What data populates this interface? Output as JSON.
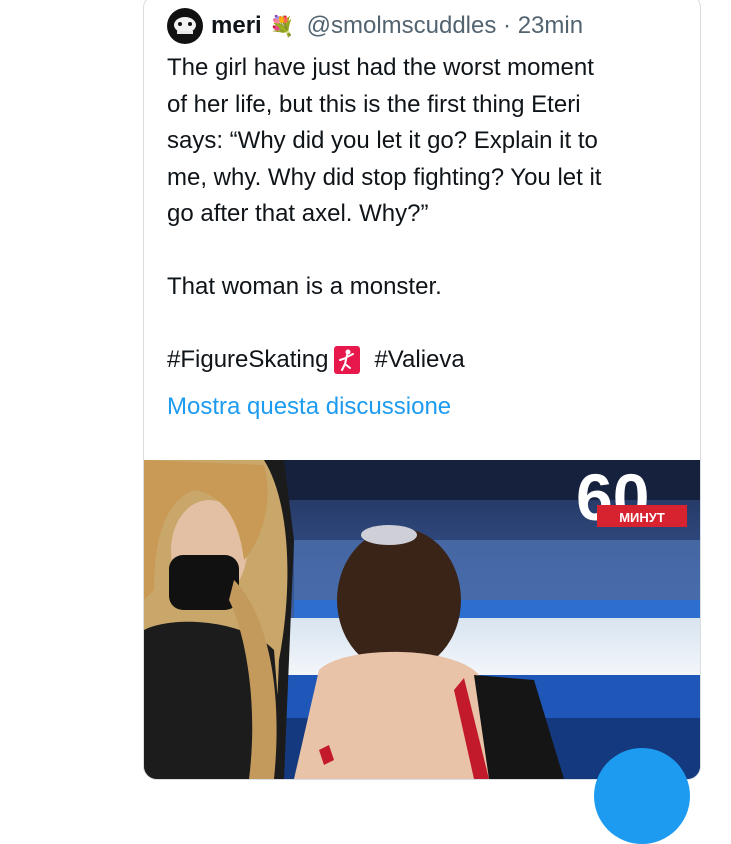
{
  "tweet": {
    "display_name": "meri",
    "name_emoji": "💐",
    "handle": "@smolmscuddles",
    "separator": "·",
    "time": "23min",
    "text_lines": [
      "The girl have just had the worst moment",
      "of her life, but this is the first thing Eteri",
      "says: “Why did you let it go? Explain it to",
      "me, why. Why did stop fighting? You let it",
      "go after that axel. Why?”"
    ],
    "text_line2": "That woman is a monster.",
    "hashtag1": "#FigureSkating",
    "hashtag1_emoji": "figure-skating-emoji",
    "hashtag2": "#Valieva",
    "show_thread": "Mostra questa discussione"
  },
  "media": {
    "logo_number": "60",
    "logo_label": "МИНУТ"
  },
  "colors": {
    "link": "#1d9bf0",
    "handle": "#536471",
    "text": "#0f1419",
    "logo_red": "#d6232f"
  }
}
